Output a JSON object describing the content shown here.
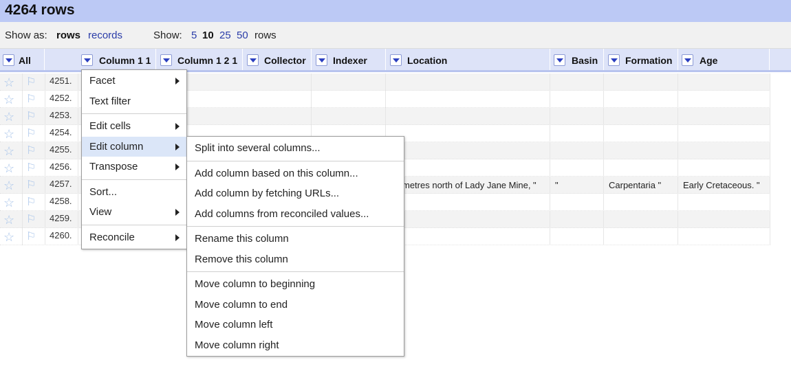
{
  "title": "4264 rows",
  "view_bar": {
    "show_as_label": "Show as:",
    "rows_mode": "rows",
    "records_mode": "records",
    "show_label": "Show:",
    "page_sizes": [
      "5",
      "10",
      "25",
      "50"
    ],
    "active_page_size": "10",
    "rows_suffix": "rows"
  },
  "columns": [
    "All",
    "Column 1 1",
    "Column 1 2 1",
    "Collector",
    "Indexer",
    "Location",
    "Basin",
    "Formation",
    "Age"
  ],
  "rows": [
    {
      "num": "4251.",
      "cells": [
        "",
        "",
        "",
        "",
        "",
        "",
        "",
        ""
      ]
    },
    {
      "num": "4252.",
      "cells": [
        "",
        "",
        "",
        "",
        "",
        "",
        "",
        ""
      ]
    },
    {
      "num": "4253.",
      "cells": [
        "",
        "",
        "",
        "",
        "",
        "",
        "",
        ""
      ]
    },
    {
      "num": "4254.",
      "cells": [
        "",
        "",
        "",
        "",
        "",
        "",
        "",
        ""
      ]
    },
    {
      "num": "4255.",
      "cells": [
        "",
        "",
        "",
        "",
        "",
        "",
        "",
        ""
      ]
    },
    {
      "num": "4256.",
      "cells": [
        "",
        "",
        "",
        "",
        "",
        "",
        "",
        ""
      ]
    },
    {
      "num": "4257.",
      "cells": [
        "",
        "",
        "",
        "",
        "metres north of Lady Jane Mine, \"",
        "\"",
        "Carpentaria \"",
        "Early Cretaceous. \""
      ]
    },
    {
      "num": "4258.",
      "cells": [
        "",
        "",
        "",
        "",
        "",
        "",
        "",
        ""
      ]
    },
    {
      "num": "4259.",
      "cells": [
        "",
        "",
        "",
        "",
        "",
        "",
        "",
        ""
      ]
    },
    {
      "num": "4260.",
      "cells": [
        "",
        "",
        "",
        "",
        "",
        "",
        "",
        ""
      ]
    }
  ],
  "column_menu": {
    "items": [
      {
        "label": "Facet",
        "submenu": true
      },
      {
        "label": "Text filter",
        "submenu": false
      },
      {
        "label": "Edit cells",
        "submenu": true
      },
      {
        "label": "Edit column",
        "submenu": true,
        "active": true
      },
      {
        "label": "Transpose",
        "submenu": true
      },
      {
        "label": "Sort...",
        "submenu": false
      },
      {
        "label": "View",
        "submenu": true
      },
      {
        "label": "Reconcile",
        "submenu": true
      }
    ]
  },
  "edit_column_submenu": {
    "items": [
      "Split into several columns...",
      "Add column based on this column...",
      "Add column by fetching URLs...",
      "Add columns from reconciled values...",
      "Rename this column",
      "Remove this column",
      "Move column to beginning",
      "Move column to end",
      "Move column left",
      "Move column right"
    ]
  },
  "icons": {
    "star": "star-icon",
    "flag": "flag-icon",
    "dropdown": "dropdown-arrow-icon",
    "submenu_arrow": "chevron-right-icon"
  },
  "colors": {
    "title_bar": "#bcc9f5",
    "header_row": "#dde3f8",
    "link": "#2a3ca8",
    "menu_highlight": "#dbe6f8"
  }
}
